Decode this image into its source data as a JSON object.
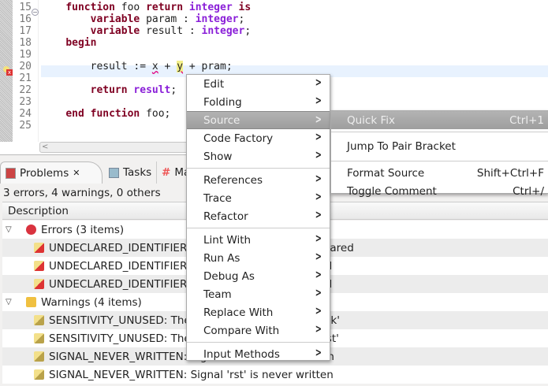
{
  "editor": {
    "lines": [
      {
        "n": "14",
        "html": ""
      },
      {
        "n": "15",
        "html": "    <span class='kw'>function</span> foo <span class='kw'>return</span> <span class='ty'>integer</span> <span class='kw'>is</span>"
      },
      {
        "n": "16",
        "html": "        <span class='kw'>variable</span> param : <span class='ty'>integer</span>;"
      },
      {
        "n": "17",
        "html": "        <span class='kw'>variable</span> result : <span class='ty'>integer</span>;"
      },
      {
        "n": "18",
        "html": "    <span class='kw'>begin</span>"
      },
      {
        "n": "19",
        "html": ""
      },
      {
        "n": "20",
        "html": "        result := <span class='err'>x</span> + <span class='err yel'>y</span> + pram;"
      },
      {
        "n": "21",
        "html": ""
      },
      {
        "n": "22",
        "html": "        <span class='kw'>return</span> <span class='ty'>result</span>;"
      },
      {
        "n": "23",
        "html": ""
      },
      {
        "n": "24",
        "html": "    <span class='kw'>end</span> <span class='kw'>function</span> foo;"
      },
      {
        "n": "25",
        "html": ""
      }
    ]
  },
  "problems": {
    "tabs": [
      "Problems",
      "Tasks",
      "Ma"
    ],
    "status": "3 errors, 4 warnings, 0 others",
    "column": "Description",
    "rows": [
      {
        "type": "group-error",
        "text": "Errors (3 items)"
      },
      {
        "type": "error",
        "text": "UNDECLARED_IDENTIFIER: Identifier 'pram' is undeclared"
      },
      {
        "type": "error",
        "text": "UNDECLARED_IDENTIFIER: Identifier 'y' is undeclared"
      },
      {
        "type": "error",
        "text": "UNDECLARED_IDENTIFIER: Identifier 'x' is undeclared"
      },
      {
        "type": "group-warning",
        "text": "Warnings (4 items)"
      },
      {
        "type": "warning",
        "text": "SENSITIVITY_UNUSED: The sensitivity list refers to 'clk'"
      },
      {
        "type": "warning",
        "text": "SENSITIVITY_UNUSED: The sensitivity list refers to 'rst'"
      },
      {
        "type": "warning",
        "text": "SIGNAL_NEVER_WRITTEN: Signal 'clk' is never written"
      },
      {
        "type": "warning",
        "text": "SIGNAL_NEVER_WRITTEN: Signal 'rst' is never written"
      }
    ]
  },
  "menu": {
    "groups": [
      [
        "Edit",
        "Folding",
        "Source",
        "Code Factory",
        "Show"
      ],
      [
        "References",
        "Trace",
        "Refactor"
      ],
      [
        "Lint With",
        "Run As",
        "Debug As",
        "Team",
        "Replace With",
        "Compare With"
      ],
      [
        "Input Methods"
      ]
    ],
    "selected": "Source"
  },
  "submenu": {
    "groups": [
      [
        {
          "label": "Quick Fix",
          "shortcut": "Ctrl+1"
        }
      ],
      [
        {
          "label": "Jump To Pair Bracket",
          "shortcut": ""
        }
      ],
      [
        {
          "label": "Format Source",
          "shortcut": "Shift+Ctrl+F"
        },
        {
          "label": "Toggle Comment",
          "shortcut": "Ctrl+/"
        }
      ]
    ],
    "selected": "Quick Fix"
  },
  "colors": {
    "keyword": "#7f0022",
    "type": "#8a1fd8",
    "selection": "#a8a8a8",
    "current_line": "#e8f2fe"
  }
}
